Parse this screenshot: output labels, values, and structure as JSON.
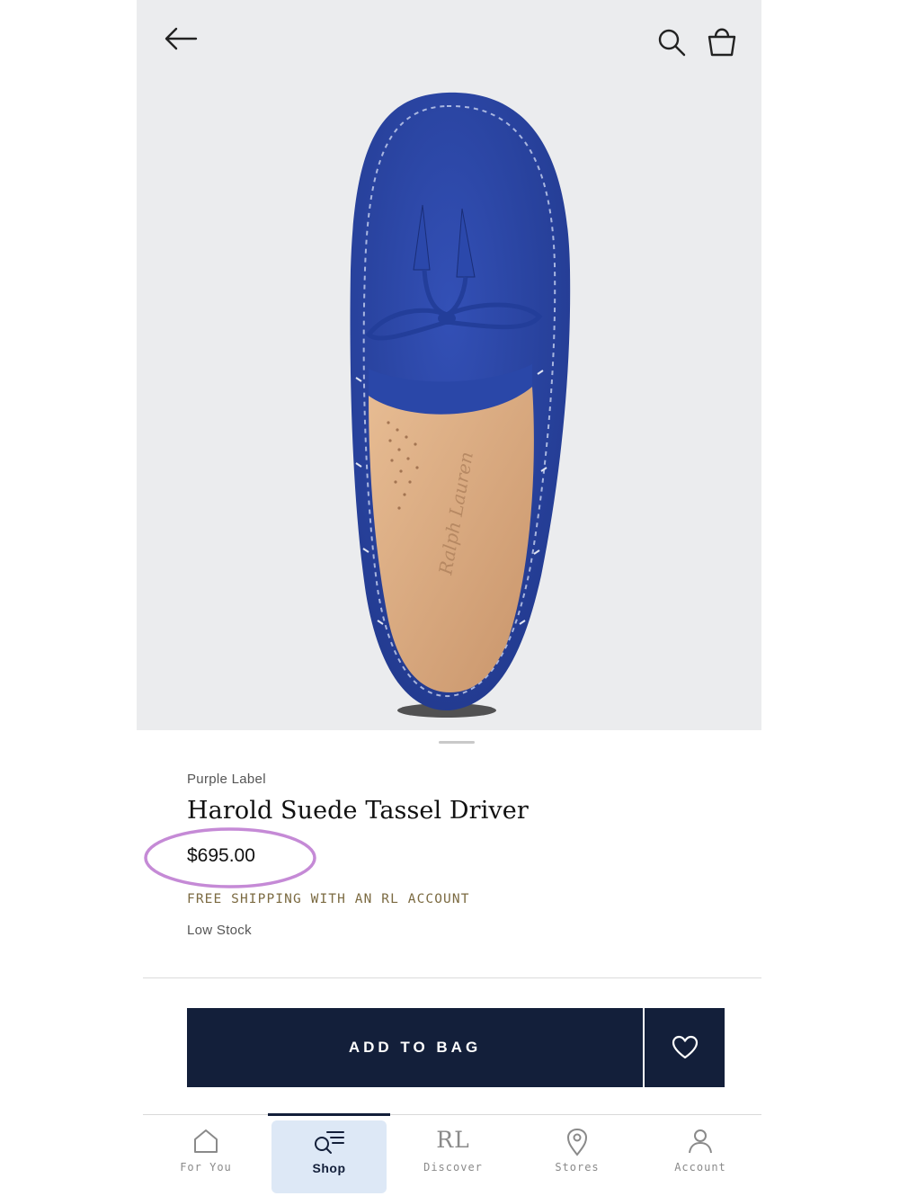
{
  "header": {
    "back_icon": "arrow-left-icon",
    "search_icon": "search-icon",
    "bag_icon": "shopping-bag-icon"
  },
  "product": {
    "brand": "Purple Label",
    "title": "Harold Suede Tassel Driver",
    "price": "$695.00",
    "shipping_note": "FREE SHIPPING WITH AN RL ACCOUNT",
    "stock_status": "Low Stock",
    "image_description_colors": {
      "suede": "#2b45a2",
      "lining": "#d8a97f",
      "background": "#ebecee"
    }
  },
  "actions": {
    "add_to_bag_label": "ADD TO BAG",
    "wishlist_icon": "heart-icon"
  },
  "annotation": {
    "price_circle_color": "#c58ad6"
  },
  "nav": {
    "items": [
      {
        "label": "For You",
        "icon": "home-icon",
        "active": false
      },
      {
        "label": "Shop",
        "icon": "shop-search-icon",
        "active": true
      },
      {
        "label": "Discover",
        "icon": "rl-logo-icon",
        "icon_text": "RL",
        "active": false
      },
      {
        "label": "Stores",
        "icon": "location-pin-icon",
        "active": false
      },
      {
        "label": "Account",
        "icon": "person-icon",
        "active": false
      }
    ],
    "active_color": "#131f3a",
    "active_bg": "#dde8f6"
  }
}
